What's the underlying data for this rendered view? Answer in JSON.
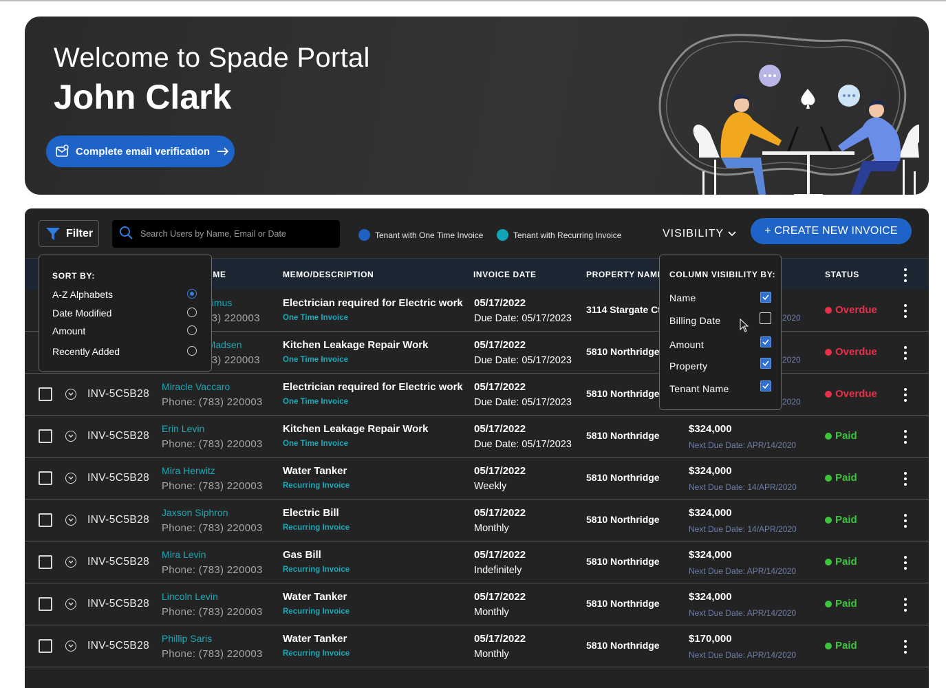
{
  "hero": {
    "welcome": "Welcome to Spade Portal",
    "user_name": "John Clark",
    "verify_label": "Complete email verification"
  },
  "toolbar": {
    "filter_label": "Filter",
    "search_placeholder": "Search Users by Name, Email or Date",
    "legend_one_time": "Tenant with One Time Invoice",
    "legend_recurring": "Tenant with Recurring Invoice",
    "visibility_label": "VISIBILITY",
    "create_label": "+ CREATE NEW INVOICE"
  },
  "colors": {
    "one_time": "#1f62c4",
    "recurring": "#12a5b8",
    "overdue": "#e8304a",
    "paid": "#3cc43c",
    "accent": "#1e64c8"
  },
  "table": {
    "headers": {
      "tenant": "T NAME",
      "memo": "MEMO/DESCRIPTION",
      "invoice_date": "INVOICE DATE",
      "property": "PROPERTY NAME",
      "status": "STATUS"
    },
    "rows": [
      {
        "id": "",
        "name": "Septimus",
        "phone": "(783) 220003",
        "memo": "Electrician required for Electric work",
        "type": "One Time Invoice",
        "date": "05/17/2022",
        "due": "Due Date: 05/17/2023",
        "property": "3114 Stargate Ct",
        "amount": "",
        "next_due": "2020",
        "status": "Overdue"
      },
      {
        "id": "",
        "name": "hiel Madsen",
        "phone": "(783) 220003",
        "memo": "Kitchen Leakage Repair Work",
        "type": "One Time Invoice",
        "date": "05/17/2022",
        "due": "Due Date: 05/17/2023",
        "property": "5810 Northridge",
        "amount": "",
        "next_due": "2020",
        "status": "Overdue"
      },
      {
        "id": "INV-5C5B28",
        "name": "Miracle Vaccaro",
        "phone": "Phone: (783) 220003",
        "memo": "Electrician required for Electric work",
        "type": "One Time Invoice",
        "date": "05/17/2022",
        "due": "Due Date: 05/17/2023",
        "property": "5810 Northridge",
        "amount": "",
        "next_due": "2020",
        "status": "Overdue"
      },
      {
        "id": "INV-5C5B28",
        "name": "Erin Levin",
        "phone": "Phone: (783) 220003",
        "memo": "Kitchen Leakage Repair Work",
        "type": "One Time Invoice",
        "date": "05/17/2022",
        "due": "Due Date: 05/17/2023",
        "property": "5810 Northridge",
        "amount": "$324,000",
        "next_due": "Next Due Date: APR/14/2020",
        "status": "Paid"
      },
      {
        "id": "INV-5C5B28",
        "name": "Mira Herwitz",
        "phone": "Phone: (783) 220003",
        "memo": "Water Tanker",
        "type": "Recurring Invoice",
        "date": "05/17/2022",
        "due": "Weekly",
        "property": "5810 Northridge",
        "amount": "$324,000",
        "next_due": "Next Due Date: 14/APR/2020",
        "status": "Paid"
      },
      {
        "id": "INV-5C5B28",
        "name": "Jaxson Siphron",
        "phone": "Phone: (783) 220003",
        "memo": "Electric Bill",
        "type": "Recurring Invoice",
        "date": "05/17/2022",
        "due": "Monthly",
        "property": "5810 Northridge",
        "amount": "$324,000",
        "next_due": "Next Due Date: 14/APR/2020",
        "status": "Paid"
      },
      {
        "id": "INV-5C5B28",
        "name": "Mira Levin",
        "phone": "Phone: (783) 220003",
        "memo": "Gas Bill",
        "type": "Recurring Invoice",
        "date": "05/17/2022",
        "due": "Indefinitely",
        "property": "5810 Northridge",
        "amount": "$324,000",
        "next_due": "Next Due Date: APR/14/2020",
        "status": "Paid"
      },
      {
        "id": "INV-5C5B28",
        "name": "Lincoln Levin",
        "phone": "Phone: (783) 220003",
        "memo": "Water Tanker",
        "type": "Recurring Invoice",
        "date": "05/17/2022",
        "due": "Monthly",
        "property": "5810 Northridge",
        "amount": "$324,000",
        "next_due": "Next Due Date: APR/14/2020",
        "status": "Paid"
      },
      {
        "id": "INV-5C5B28",
        "name": "Phillip Saris",
        "phone": "Phone: (783) 220003",
        "memo": "Water Tanker",
        "type": "Recurring Invoice",
        "date": "05/17/2022",
        "due": "Monthly",
        "property": "5810 Northridge",
        "amount": "$170,000",
        "next_due": "Next Due Date: APR/14/2020",
        "status": "Paid"
      }
    ]
  },
  "sort_menu": {
    "title": "SORT BY:",
    "options": [
      {
        "label": "A-Z Alphabets",
        "selected": true
      },
      {
        "label": "Date Modified",
        "selected": false
      },
      {
        "label": "Amount",
        "selected": false
      },
      {
        "label": "Recently Added",
        "selected": false
      }
    ]
  },
  "visibility_menu": {
    "title": "COLUMN VISIBILITY BY:",
    "options": [
      {
        "label": "Name",
        "checked": true
      },
      {
        "label": "Billing Date",
        "checked": false
      },
      {
        "label": "Amount",
        "checked": true
      },
      {
        "label": "Property",
        "checked": true
      },
      {
        "label": "Tenant Name",
        "checked": true
      }
    ]
  }
}
